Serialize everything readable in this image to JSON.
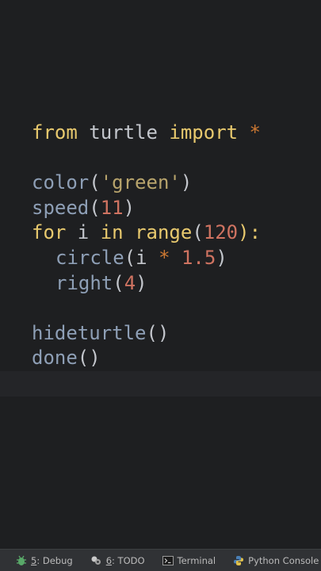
{
  "code": {
    "lines": [
      [
        {
          "t": "from",
          "c": "kw"
        },
        {
          "t": " turtle ",
          "c": "plain"
        },
        {
          "t": "import",
          "c": "kw"
        },
        {
          "t": " *",
          "c": "op"
        }
      ],
      [],
      [
        {
          "t": "color",
          "c": "fn"
        },
        {
          "t": "(",
          "c": "plain"
        },
        {
          "t": "'green'",
          "c": "str"
        },
        {
          "t": ")",
          "c": "plain"
        }
      ],
      [
        {
          "t": "speed",
          "c": "fn"
        },
        {
          "t": "(",
          "c": "plain"
        },
        {
          "t": "11",
          "c": "num"
        },
        {
          "t": ")",
          "c": "plain"
        }
      ],
      [
        {
          "t": "for",
          "c": "kw"
        },
        {
          "t": " i ",
          "c": "plain"
        },
        {
          "t": "in",
          "c": "kw"
        },
        {
          "t": " ",
          "c": "plain"
        },
        {
          "t": "range",
          "c": "kw"
        },
        {
          "t": "(",
          "c": "plain"
        },
        {
          "t": "120",
          "c": "num"
        },
        {
          "t": "):",
          "c": "kw"
        }
      ],
      [
        {
          "t": "  ",
          "c": "indent"
        },
        {
          "t": "circle",
          "c": "fn"
        },
        {
          "t": "(i ",
          "c": "plain"
        },
        {
          "t": "*",
          "c": "op"
        },
        {
          "t": " ",
          "c": "plain"
        },
        {
          "t": "1.5",
          "c": "num"
        },
        {
          "t": ")",
          "c": "plain"
        }
      ],
      [
        {
          "t": "  ",
          "c": "indent"
        },
        {
          "t": "right",
          "c": "fn"
        },
        {
          "t": "(",
          "c": "plain"
        },
        {
          "t": "4",
          "c": "num"
        },
        {
          "t": ")",
          "c": "plain"
        }
      ],
      [],
      [
        {
          "t": "hideturtle",
          "c": "fn"
        },
        {
          "t": "()",
          "c": "plain"
        }
      ],
      [
        {
          "t": "done",
          "c": "fn"
        },
        {
          "t": "()",
          "c": "plain"
        }
      ],
      []
    ]
  },
  "statusbar": {
    "debug": {
      "num": "5",
      "label": ": Debug",
      "icon": "bug-icon"
    },
    "todo": {
      "num": "6",
      "label": ": TODO",
      "icon": "todo-icon"
    },
    "terminal": {
      "label": "Terminal",
      "icon": "terminal-icon"
    },
    "python_console": {
      "label": "Python Console",
      "icon": "python-icon"
    }
  }
}
